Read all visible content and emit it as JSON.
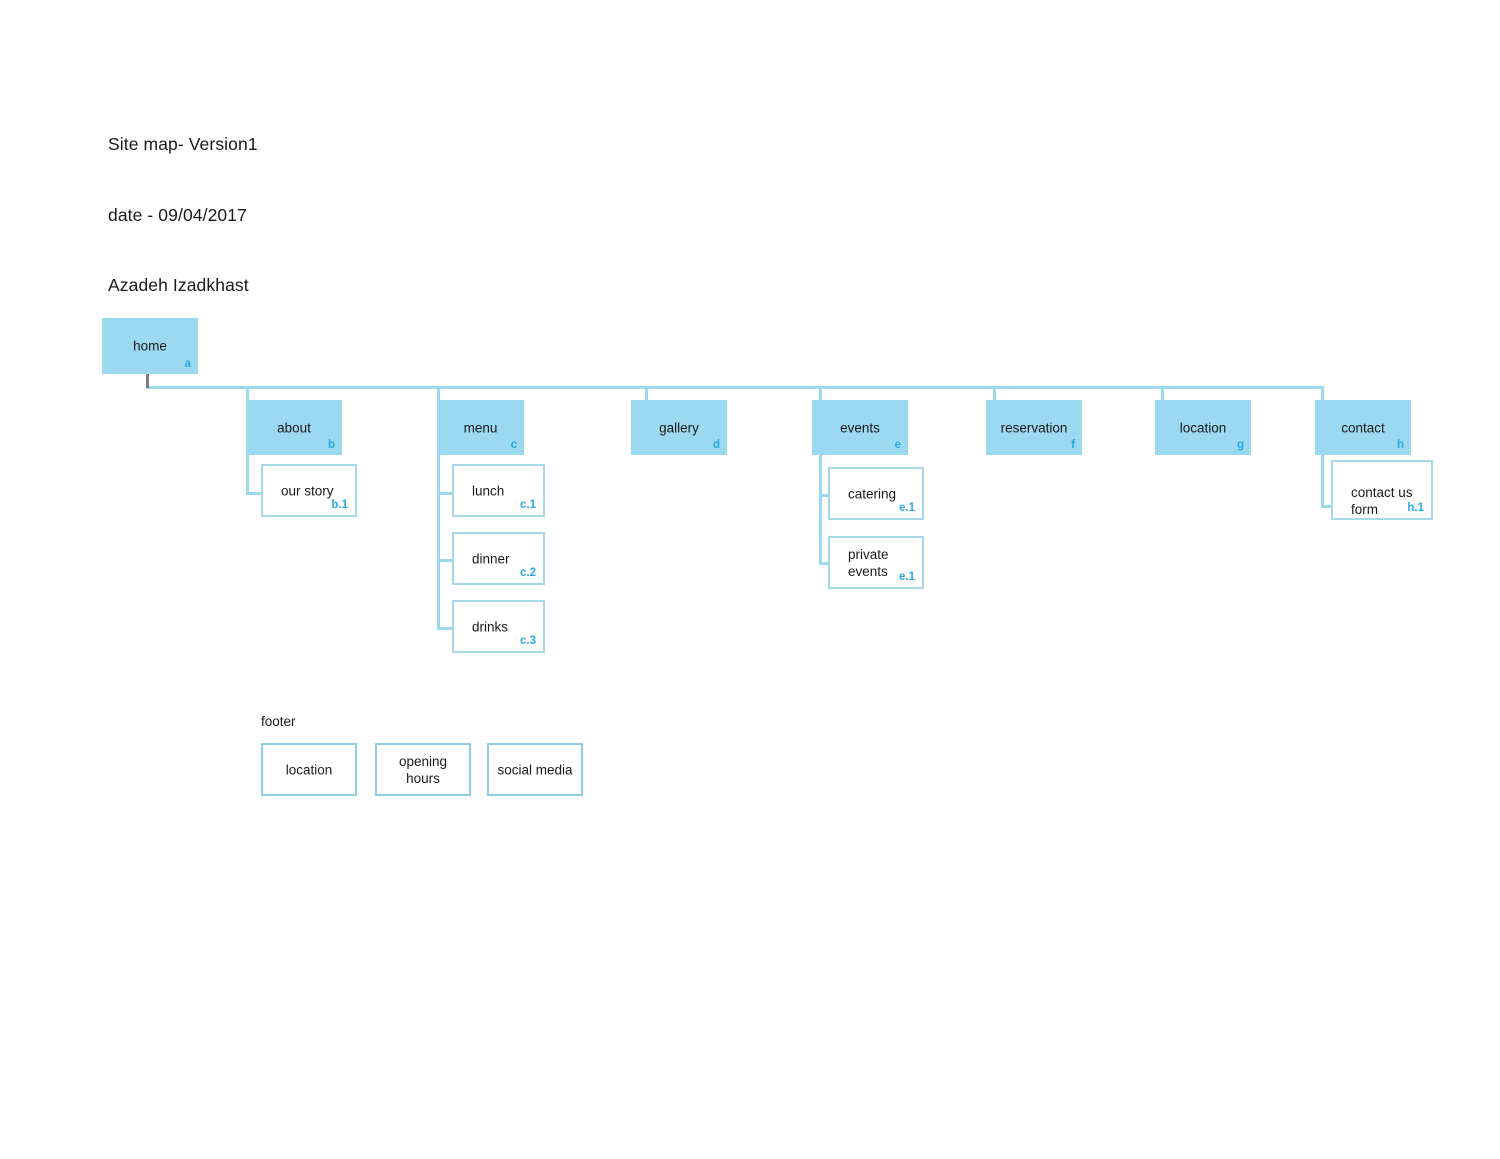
{
  "header": {
    "line1": "Site map- Version1",
    "line2": "date - 09/04/2017",
    "line3": "Azadeh Izadkhast"
  },
  "colors": {
    "node_fill": "#9ad9ef",
    "node_border": "#a5d9ea",
    "id_label": "#29a9e0",
    "connector": "#9ad9ef",
    "root_stem": "#7d7d7d",
    "text": "#1a1a1a",
    "background": "#ffffff"
  },
  "root": {
    "label": "home",
    "id": "a"
  },
  "level1": [
    {
      "label": "about",
      "id": "b"
    },
    {
      "label": "menu",
      "id": "c"
    },
    {
      "label": "gallery",
      "id": "d"
    },
    {
      "label": "events",
      "id": "e"
    },
    {
      "label": "reservation",
      "id": "f"
    },
    {
      "label": "location",
      "id": "g"
    },
    {
      "label": "contact",
      "id": "h"
    }
  ],
  "children": {
    "about": [
      {
        "label": "our story",
        "id": "b.1"
      }
    ],
    "menu": [
      {
        "label": "lunch",
        "id": "c.1"
      },
      {
        "label": "dinner",
        "id": "c.2"
      },
      {
        "label": "drinks",
        "id": "c.3"
      }
    ],
    "events": [
      {
        "label": "catering",
        "id": "e.1"
      },
      {
        "label": "private events",
        "id": "e.1"
      }
    ],
    "contact": [
      {
        "label": "contact us form",
        "id": "h.1"
      }
    ]
  },
  "footer": {
    "caption": "footer",
    "items": [
      {
        "label": "location"
      },
      {
        "label": "opening hours"
      },
      {
        "label": "social media"
      }
    ]
  }
}
